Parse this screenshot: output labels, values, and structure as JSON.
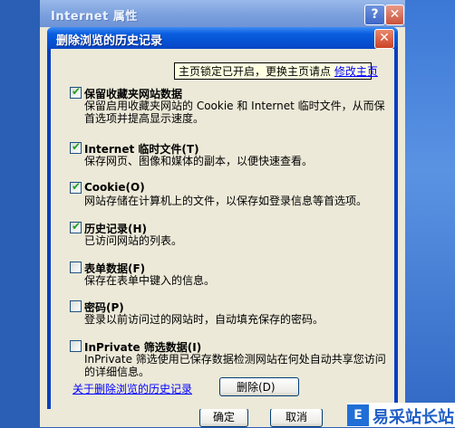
{
  "outer_window": {
    "title": "Internet 属性",
    "help_glyph": "?",
    "close_glyph": "✕",
    "ok_label": "确定",
    "cancel_label": "取消"
  },
  "dialog": {
    "title": "删除浏览的历史记录",
    "close_glyph": "✕",
    "tooltip": {
      "text": "主页锁定已开启，更换主页请点 ",
      "link": "修改主页"
    },
    "items": [
      {
        "label": "保留收藏夹网站数据",
        "checked": true,
        "desc": [
          "保留启用收藏夹网站的 Cookie 和 Internet 临时文件，从而保",
          "首选项并提高显示速度。"
        ]
      },
      {
        "label": "Internet 临时文件(T)",
        "checked": true,
        "desc": [
          "保存网页、图像和媒体的副本，以便快速查看。"
        ]
      },
      {
        "label": "Cookie(O)",
        "checked": true,
        "desc": [
          "网站存储在计算机上的文件，以保存如登录信息等首选项。"
        ]
      },
      {
        "label": "历史记录(H)",
        "checked": true,
        "desc": [
          "已访问网站的列表。"
        ]
      },
      {
        "label": "表单数据(F)",
        "checked": false,
        "desc": [
          "保存在表单中键入的信息。"
        ]
      },
      {
        "label": "密码(P)",
        "checked": false,
        "desc": [
          "登录以前访问过的网站时，自动填充保存的密码。"
        ]
      },
      {
        "label": "InPrivate 筛选数据(I)",
        "checked": false,
        "desc": [
          "InPrivate 筛选使用已保存数据检测网站在何处自动共享您访问",
          "的详细信息。"
        ]
      }
    ],
    "about_link": "关于删除浏览的历史记录",
    "delete_label": "删除(D)"
  },
  "watermark": {
    "brand_text": "易采站长站",
    "brand_mark": "E"
  },
  "colors": {
    "xp_blue": "#0650d2",
    "dialog_face": "#ece9d8",
    "link": "#0000ff",
    "check": "#21a121"
  },
  "checkmark_glyph": "✔"
}
